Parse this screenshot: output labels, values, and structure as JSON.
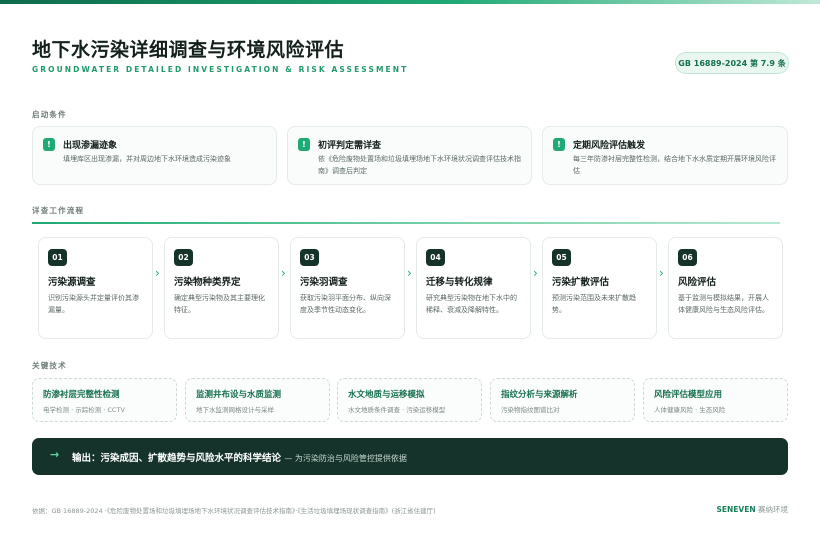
{
  "header": {
    "title": "地下水污染详细调查与环境风险评估",
    "subtitle": "GROUNDWATER DETAILED INVESTIGATION & RISK ASSESSMENT",
    "standard_badge": "GB 16889-2024 第 7.9 条"
  },
  "triggers": {
    "label": "启动条件",
    "items": [
      {
        "flag": "!",
        "title": "出现渗漏迹象",
        "desc": "填埋库区出现渗漏，并对周边地下水环境造成污染迹象"
      },
      {
        "flag": "!",
        "title": "初评判定需详查",
        "desc": "依《危险废物处置场和垃圾填埋场地下水环境状况调查评估技术指南》调查后判定"
      },
      {
        "flag": "!",
        "title": "定期风险评估触发",
        "desc": "每三年防渗衬层完整性检测，结合地下水水质定期开展环境风险评估"
      }
    ]
  },
  "workflow": {
    "label": "详查工作流程",
    "steps": [
      {
        "num": "01",
        "title": "污染源调查",
        "desc": "识别污染源头并定量评价其渗漏量。"
      },
      {
        "num": "02",
        "title": "污染物种类界定",
        "desc": "确定典型污染物及其主要理化特征。"
      },
      {
        "num": "03",
        "title": "污染羽调查",
        "desc": "获取污染羽平面分布、纵向深度及季节性动态变化。"
      },
      {
        "num": "04",
        "title": "迁移与转化规律",
        "desc": "研究典型污染物在地下水中的稀释、衰减及降解特性。"
      },
      {
        "num": "05",
        "title": "污染扩散评估",
        "desc": "预测污染范围及未来扩散趋势。"
      },
      {
        "num": "06",
        "title": "风险评估",
        "desc": "基于监测与模拟结果，开展人体健康风险与生态风险评估。"
      }
    ]
  },
  "techniques": {
    "label": "关键技术",
    "items": [
      {
        "title": "防渗衬层完整性检测",
        "desc": "电学检测 · 示踪检测 · CCTV"
      },
      {
        "title": "监测井布设与水质监测",
        "desc": "地下水监测网格设计与采样"
      },
      {
        "title": "水文地质与运移模拟",
        "desc": "水文地质条件调查 · 污染运移模型"
      },
      {
        "title": "指纹分析与来源解析",
        "desc": "污染物指纹图谱比对"
      },
      {
        "title": "风险评估模型应用",
        "desc": "人体健康风险 · 生态风险"
      }
    ]
  },
  "output": {
    "arrow": "→",
    "text": "输出：污染成因、扩散趋势与风险水平的科学结论",
    "sub": "— 为污染防治与风险管控提供依据"
  },
  "footer": {
    "source": "依据：GB 16889-2024 ·《危险废物处置场和垃圾填埋场地下水环境状况调查评估技术指南》·《生活垃圾填埋场现状调查指南》(浙江省住建厅)",
    "brand_en": "SENEVEN",
    "brand_cn": "赛纳环境"
  },
  "colors": {
    "accent": "#1fa974",
    "dark": "#15332a",
    "text": "#13201b"
  }
}
